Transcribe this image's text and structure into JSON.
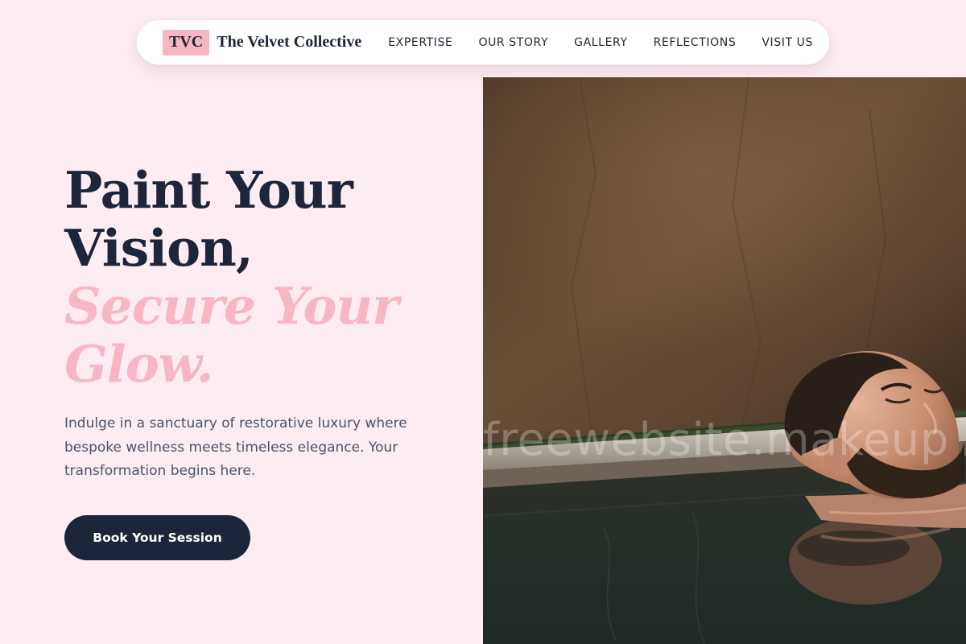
{
  "brand": {
    "mark": "TVC",
    "name": "The Velvet Collective"
  },
  "nav": {
    "items": [
      {
        "label": "EXPERTISE"
      },
      {
        "label": "OUR STORY"
      },
      {
        "label": "GALLERY"
      },
      {
        "label": "REFLECTIONS"
      },
      {
        "label": "VISIT US"
      }
    ]
  },
  "hero": {
    "title_line1": "Paint Your",
    "title_line2": "Vision,",
    "title_accent_line1": "Secure Your",
    "title_accent_line2": "Glow.",
    "description": "Indulge in a sanctuary of restorative luxury where bespoke wellness meets timeless elegance. Your transformation begins here.",
    "cta_label": "Book Your Session",
    "watermark": "freewebsite.makeup"
  },
  "colors": {
    "background": "#fdedf3",
    "accent_pink": "#f8b5c3",
    "navy": "#1c2539",
    "body_text": "#4a5368"
  }
}
